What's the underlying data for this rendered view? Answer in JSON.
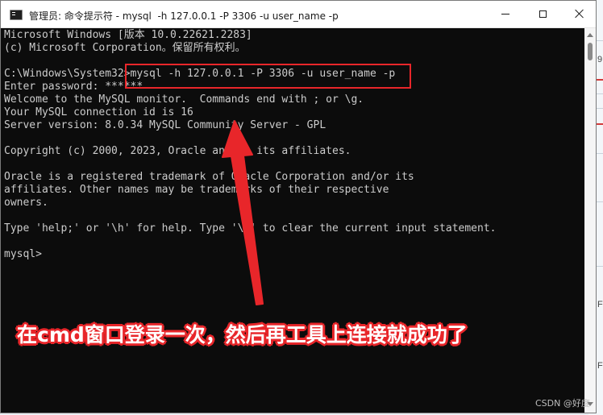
{
  "window": {
    "title": "管理员: 命令提示符 - mysql  -h 127.0.0.1 -P 3306 -u user_name -p",
    "controls": {
      "minimize_icon": "minimize-icon",
      "maximize_icon": "maximize-icon",
      "close_icon": "close-icon"
    }
  },
  "console": {
    "lines": [
      "Microsoft Windows [版本 10.0.22621.2283]",
      "(c) Microsoft Corporation。保留所有权利。",
      "",
      "C:\\Windows\\System32>mysql -h 127.0.0.1 -P 3306 -u user_name -p",
      "Enter password: ******",
      "Welcome to the MySQL monitor.  Commands end with ; or \\g.",
      "Your MySQL connection id is 16",
      "Server version: 8.0.34 MySQL Community Server - GPL",
      "",
      "Copyright (c) 2000, 2023, Oracle and/or its affiliates.",
      "",
      "Oracle is a registered trademark of Oracle Corporation and/or its",
      "affiliates. Other names may be trademarks of their respective",
      "owners.",
      "",
      "Type 'help;' or '\\h' for help. Type '\\c' to clear the current input statement.",
      "",
      "mysql>"
    ]
  },
  "annotation": {
    "caption": "在cmd窗口登录一次，然后再工具上连接就成功了",
    "color": "#e8262a"
  },
  "watermark": "CSDN @好度",
  "background_app": {
    "letters": [
      "9",
      "F",
      "F"
    ]
  }
}
